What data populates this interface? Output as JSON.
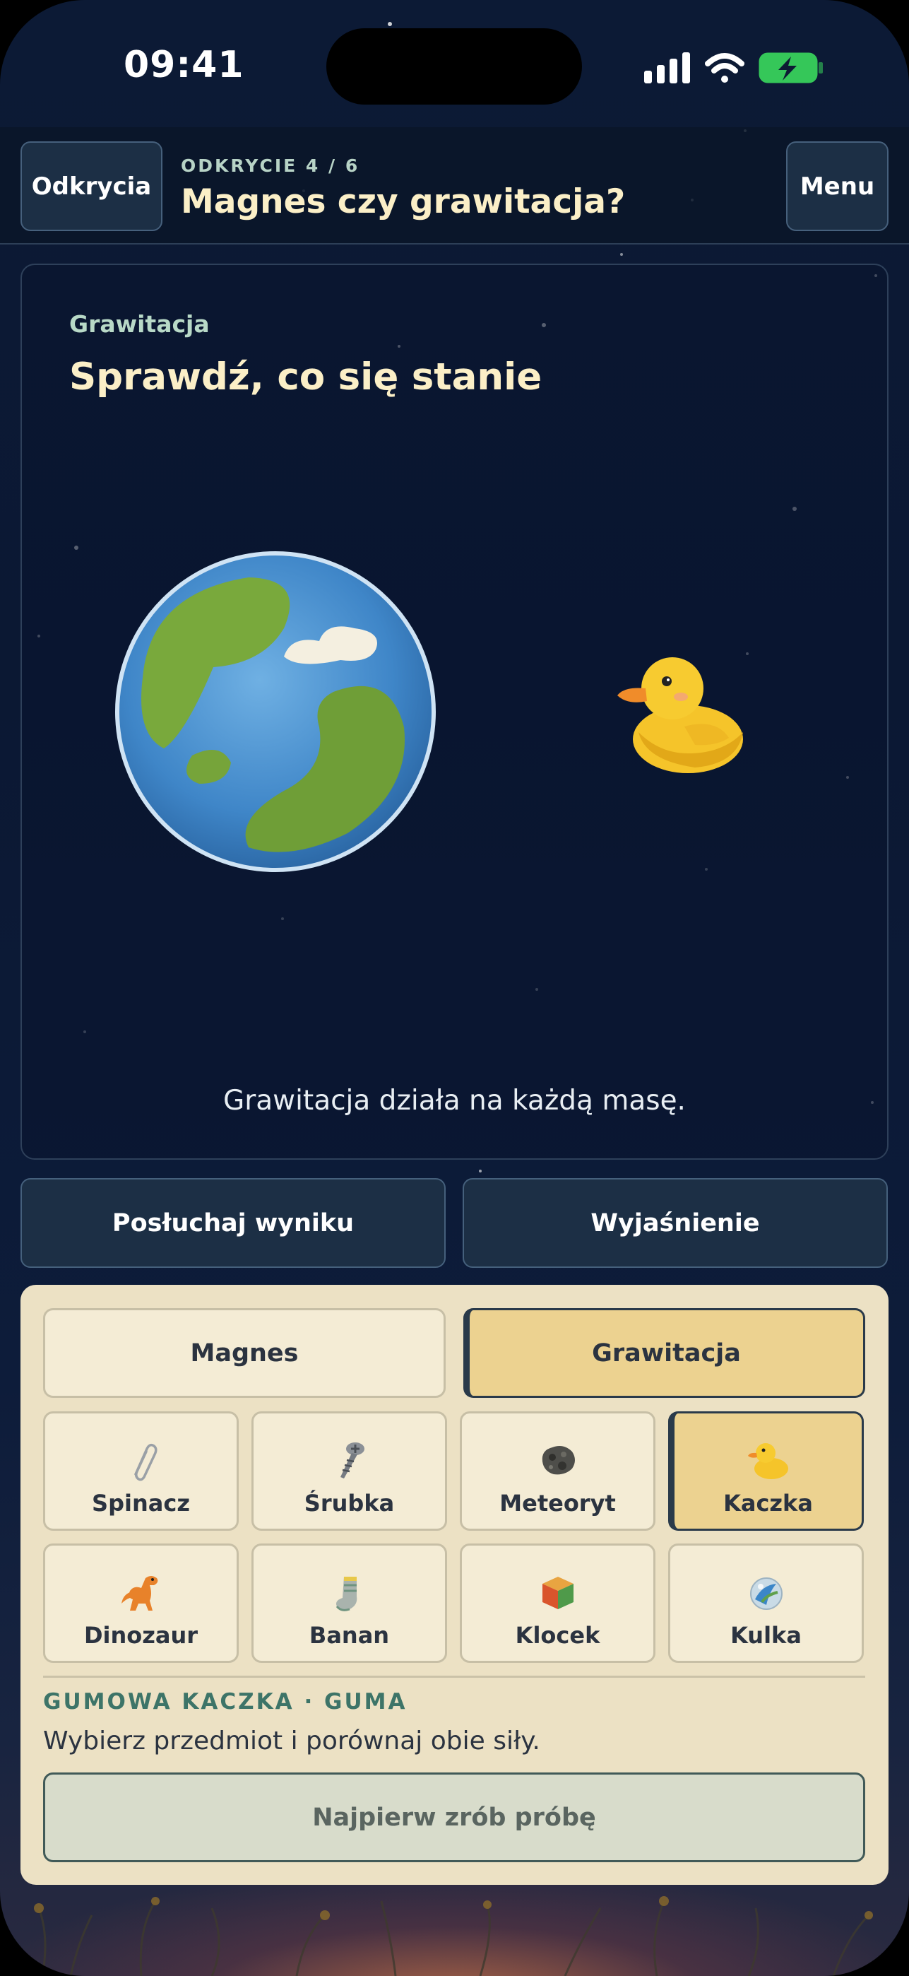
{
  "status_bar": {
    "time": "09:41"
  },
  "header": {
    "left_button": "Odkrycia",
    "subtitle": "ODKRYCIE 4 / 6",
    "title": "Magnes czy grawitacja?",
    "right_button": "Menu"
  },
  "experiment": {
    "label": "Grawitacja",
    "title": "Sprawdź, co się stanie",
    "caption": "Grawitacja działa na każdą masę."
  },
  "actions": {
    "listen": "Posłuchaj wyniku",
    "explain": "Wyjaśnienie"
  },
  "forces": {
    "magnet": "Magnes",
    "gravity": "Grawitacja",
    "selected": "Grawitacja"
  },
  "items": [
    {
      "label": "Spinacz",
      "icon": "paperclip-icon"
    },
    {
      "label": "Śrubka",
      "icon": "screw-icon"
    },
    {
      "label": "Meteoryt",
      "icon": "meteorite-icon"
    },
    {
      "label": "Kaczka",
      "icon": "duck-icon",
      "selected": true
    },
    {
      "label": "Dinozaur",
      "icon": "dinosaur-icon"
    },
    {
      "label": "Banan",
      "icon": "sock-icon"
    },
    {
      "label": "Klocek",
      "icon": "block-icon"
    },
    {
      "label": "Kulka",
      "icon": "marble-icon"
    }
  ],
  "selection": {
    "meta": "GUMOWA KACZKA · GUMA",
    "hint": "Wybierz przedmiot i porównaj obie siły.",
    "try_button": "Najpierw zrób próbę"
  }
}
